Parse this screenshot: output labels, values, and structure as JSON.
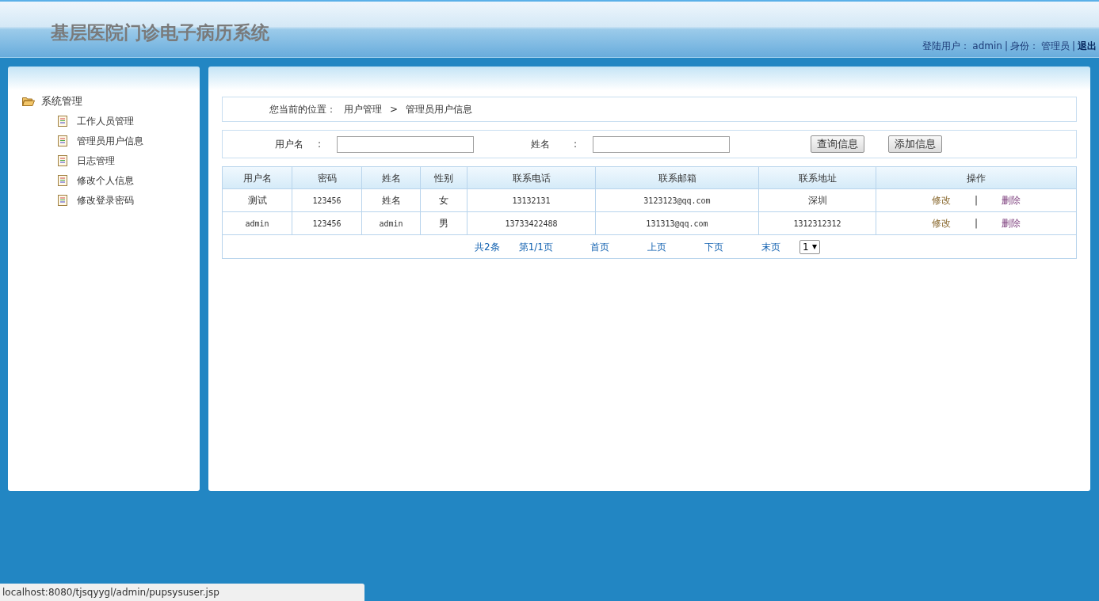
{
  "header": {
    "title": "基层医院门诊电子病历系统",
    "user_label": "登陆用户：",
    "user": "admin",
    "role_label": "身份：",
    "role": "管理员",
    "logout": "退出",
    "separator": "|"
  },
  "sidebar": {
    "group": {
      "label": "系统管理",
      "expanded": true,
      "children": [
        {
          "label": "工作人员管理"
        },
        {
          "label": "管理员用户信息"
        },
        {
          "label": "日志管理"
        },
        {
          "label": "修改个人信息"
        },
        {
          "label": "修改登录密码"
        }
      ]
    }
  },
  "breadcrumb": {
    "label": "您当前的位置：",
    "items": [
      "用户管理",
      "管理员用户信息"
    ],
    "separator": ">"
  },
  "search": {
    "fields": [
      {
        "label": "用户名",
        "colon": ":"
      },
      {
        "label": "姓名",
        "colon": ":"
      }
    ],
    "buttons": [
      "查询信息",
      "添加信息"
    ]
  },
  "table": {
    "columns": [
      "用户名",
      "密码",
      "姓名",
      "性别",
      "联系电话",
      "联系邮箱",
      "联系地址",
      "操作"
    ],
    "rows": [
      {
        "cells": [
          "测试",
          "123456",
          "姓名",
          "女",
          "13132131",
          "3123123@qq.com",
          "深圳"
        ],
        "actions": [
          "修改",
          "|",
          "删除"
        ]
      },
      {
        "cells": [
          "admin",
          "123456",
          "admin",
          "男",
          "13733422488",
          "131313@qq.com",
          "1312312312"
        ],
        "actions": [
          "修改",
          "|",
          "删除"
        ]
      }
    ]
  },
  "pagination": {
    "total": "共2条",
    "page": "第1/1页",
    "links": [
      "首页",
      "上页",
      "下页",
      "末页"
    ],
    "page_select": "1"
  },
  "status_bar": "localhost:8080/tjsqyygl/admin/pupsysuser.jsp"
}
